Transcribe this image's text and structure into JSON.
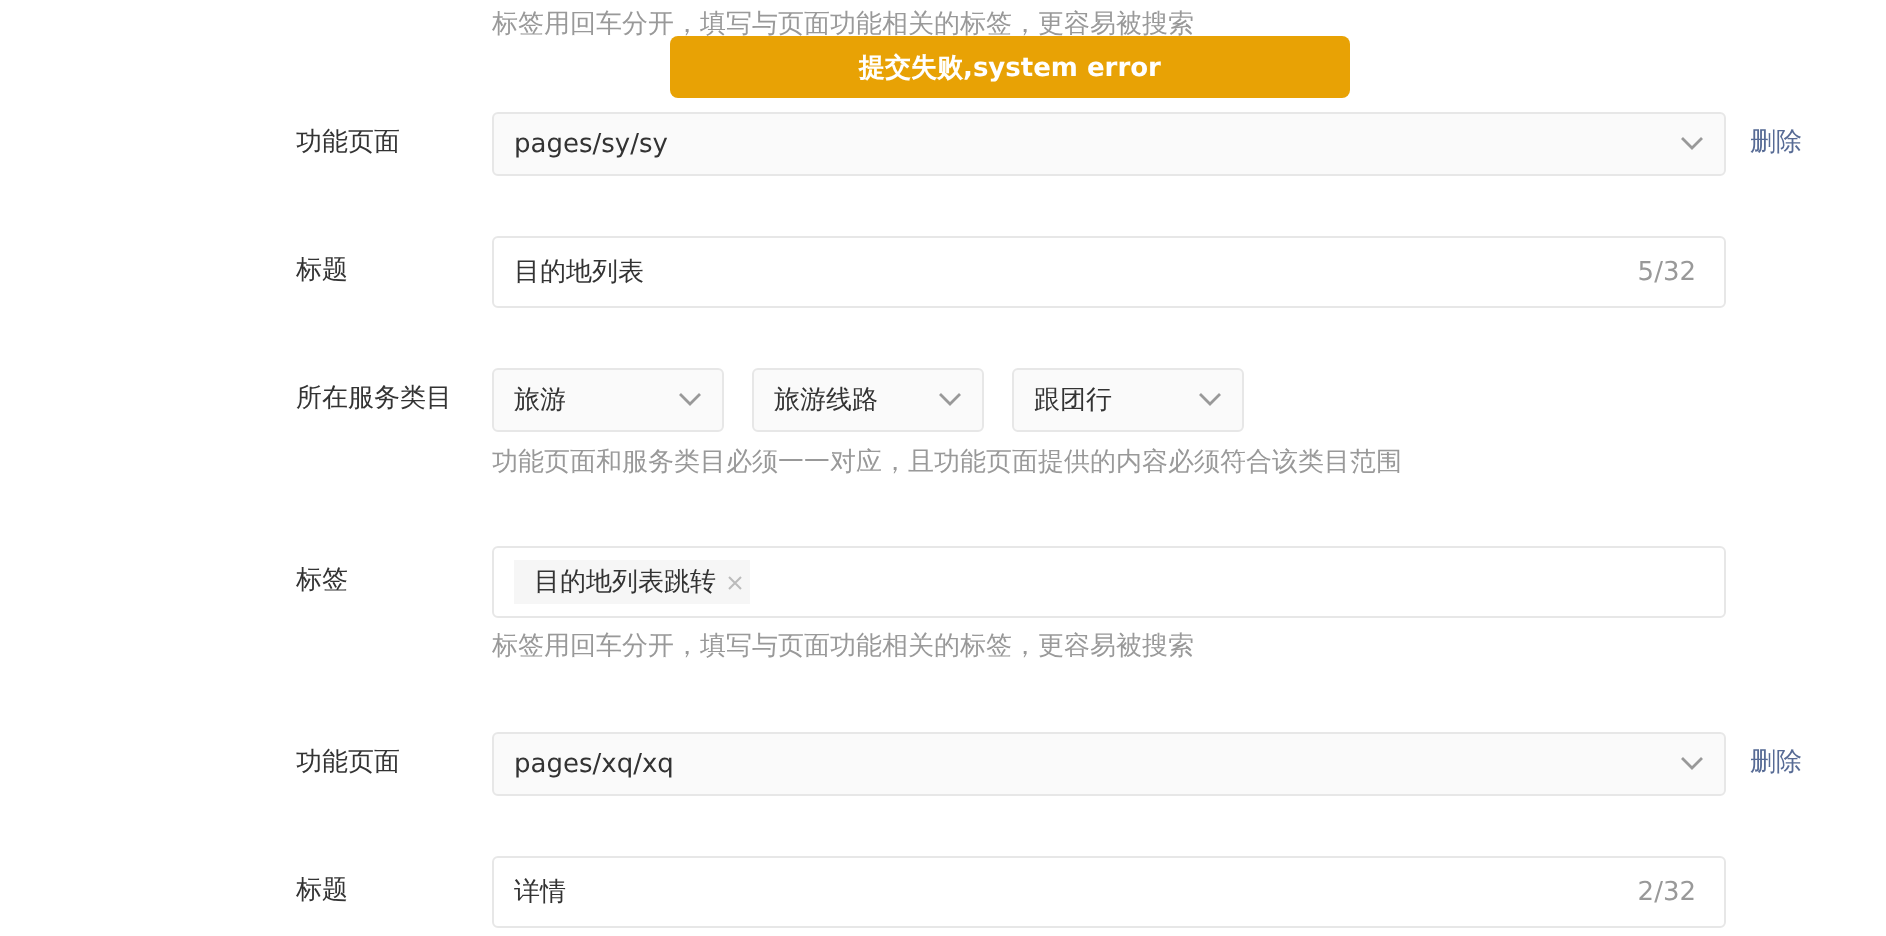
{
  "toast": {
    "message": "提交失败,system error"
  },
  "rows": [
    {
      "kind": "hint",
      "hint": "标签用回车分开，填写与页面功能相关的标签，更容易被搜索"
    },
    {
      "kind": "page",
      "label": "功能页面",
      "value": "pages/sy/sy",
      "action": "删除"
    },
    {
      "kind": "title",
      "label": "标题",
      "value": "目的地列表",
      "counter": "5/32"
    },
    {
      "kind": "category",
      "label": "所在服务类目",
      "selects": [
        "旅游",
        "旅游线路",
        "跟团行"
      ],
      "hint": "功能页面和服务类目必须一一对应，且功能页面提供的内容必须符合该类目范围"
    },
    {
      "kind": "tags",
      "label": "标签",
      "tags": [
        "目的地列表跳转"
      ],
      "hint": "标签用回车分开，填写与页面功能相关的标签，更容易被搜索"
    },
    {
      "kind": "page",
      "label": "功能页面",
      "value": "pages/xq/xq",
      "action": "删除"
    },
    {
      "kind": "title",
      "label": "标题",
      "value": "详情",
      "counter": "2/32"
    }
  ]
}
